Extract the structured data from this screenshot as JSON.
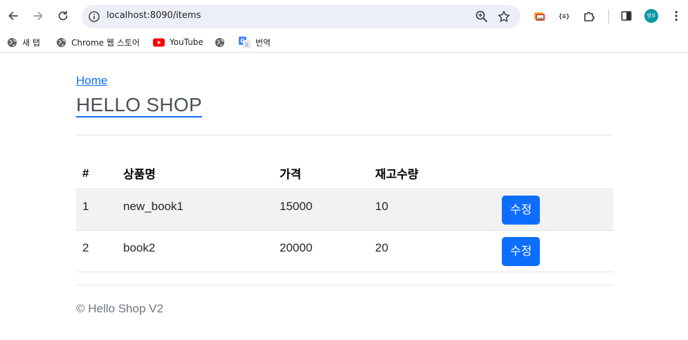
{
  "browser": {
    "url": "localhost:8090/items",
    "avatar_initials": "영우",
    "bookmarks": [
      {
        "label": "새 탭"
      },
      {
        "label": "Chrome 웹 스토어"
      },
      {
        "label": "YouTube"
      },
      {
        "label": ""
      },
      {
        "label": "번역"
      }
    ]
  },
  "page": {
    "home_link": "Home",
    "title": "HELLO SHOP",
    "table": {
      "headers": [
        "#",
        "상품명",
        "가격",
        "재고수량",
        ""
      ],
      "rows": [
        {
          "id": "1",
          "name": "new_book1",
          "price": "15000",
          "quantity": "10",
          "action": "수정"
        },
        {
          "id": "2",
          "name": "book2",
          "price": "20000",
          "quantity": "20",
          "action": "수정"
        }
      ]
    },
    "footer": "© Hello Shop V2"
  },
  "colors": {
    "primary": "#0d6efd",
    "avatar": "#0a97a6",
    "stripe": "#f2f2f2"
  }
}
